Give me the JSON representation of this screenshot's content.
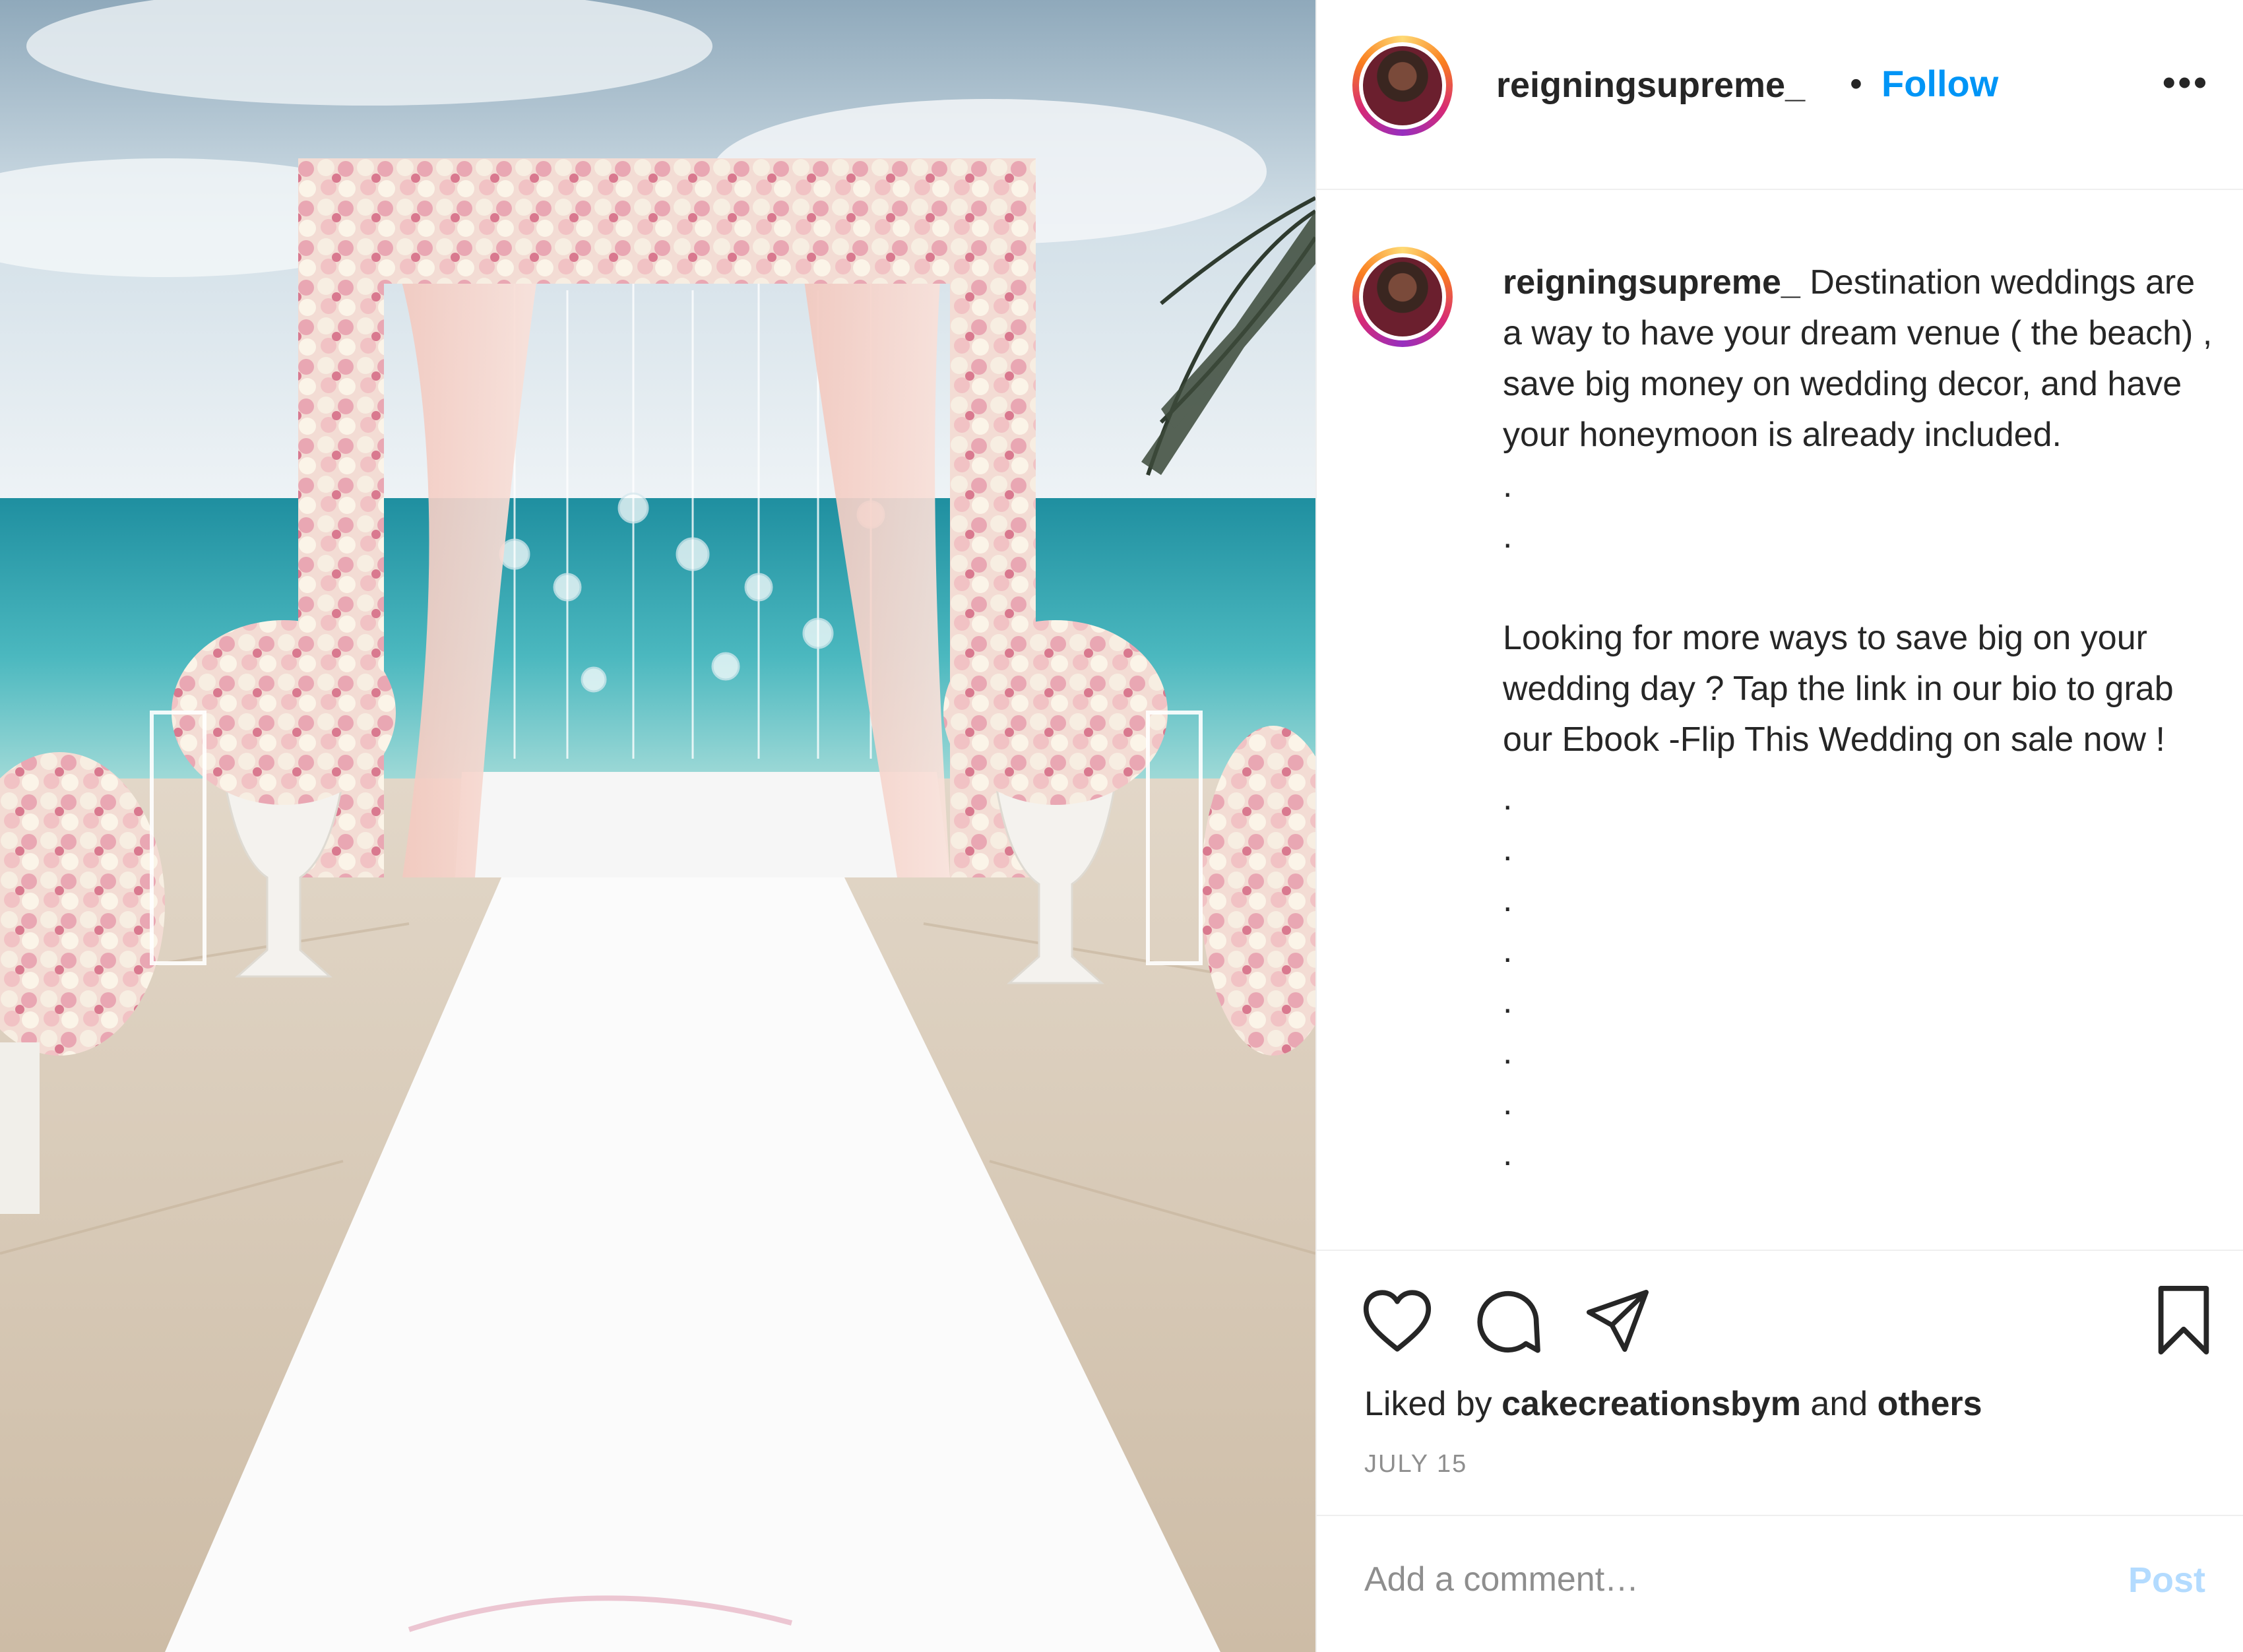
{
  "post": {
    "username": "reigningsupreme_",
    "separator": "•",
    "follow_label": "Follow",
    "more_label": "•••",
    "caption": {
      "username": "reigningsupreme_",
      "paragraph1": "Destination weddings are a way to have your dream venue ( the beach) , save big money on wedding decor, and have your honeymoon is already included.",
      "dots_a": [
        ".",
        "."
      ],
      "paragraph2": "Looking for more ways to save big on your wedding day ? Tap the link in our bio to grab our Ebook -Flip This Wedding on sale now !",
      "dots_b": [
        ".",
        ".",
        ".",
        ".",
        ".",
        ".",
        ".",
        "."
      ]
    },
    "likes": {
      "prefix": "Liked by ",
      "user": "cakecreationsbym",
      "middle": " and ",
      "suffix": "others"
    },
    "date": "JULY 15",
    "comment_placeholder": "Add a comment…",
    "post_label": "Post",
    "icons": {
      "like": "heart-icon",
      "comment": "comment-icon",
      "share": "send-icon",
      "save": "bookmark-icon"
    },
    "colors": {
      "follow": "#0095f6",
      "post_disabled": "#b3dbff",
      "muted": "#8e8e8e"
    }
  }
}
